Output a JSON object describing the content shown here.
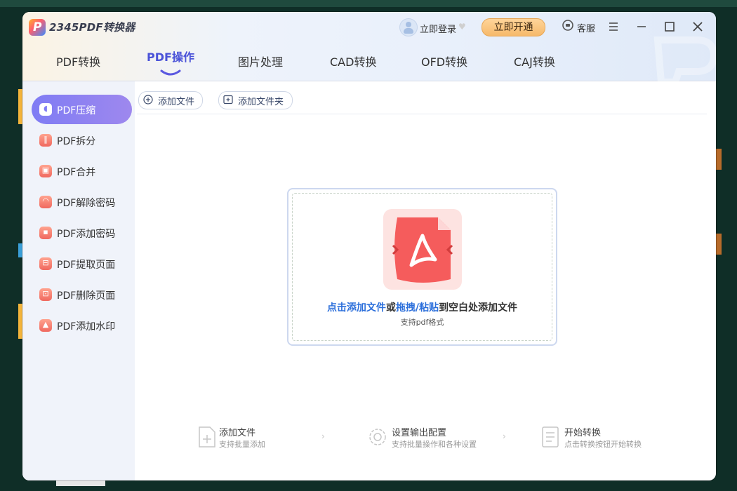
{
  "app": {
    "title": "2345PDF转换器",
    "logo_letter": "P"
  },
  "header": {
    "login_label": "立即登录",
    "vip_button": "立即开通",
    "service_label": "客服"
  },
  "tabs": [
    {
      "label": "PDF转换",
      "active": false
    },
    {
      "label": "PDF操作",
      "active": true
    },
    {
      "label": "图片处理",
      "active": false
    },
    {
      "label": "CAD转换",
      "active": false
    },
    {
      "label": "OFD转换",
      "active": false
    },
    {
      "label": "CAJ转换",
      "active": false
    }
  ],
  "sidebar": {
    "items": [
      {
        "label": "PDF压缩",
        "icon": "compress-icon",
        "active": true
      },
      {
        "label": "PDF拆分",
        "icon": "split-icon",
        "active": false
      },
      {
        "label": "PDF合并",
        "icon": "merge-icon",
        "active": false
      },
      {
        "label": "PDF解除密码",
        "icon": "unlock-icon",
        "active": false
      },
      {
        "label": "PDF添加密码",
        "icon": "lock-icon",
        "active": false
      },
      {
        "label": "PDF提取页面",
        "icon": "extract-icon",
        "active": false
      },
      {
        "label": "PDF删除页面",
        "icon": "delete-page-icon",
        "active": false
      },
      {
        "label": "PDF添加水印",
        "icon": "watermark-icon",
        "active": false
      }
    ]
  },
  "toolbar": {
    "add_file": "添加文件",
    "add_folder": "添加文件夹"
  },
  "dropzone": {
    "link_add": "点击添加文件",
    "or": "或",
    "link_drag": "拖拽/粘贴",
    "rest": "到空白处添加文件",
    "sub": "支持pdf格式"
  },
  "steps": [
    {
      "title": "添加文件",
      "sub": "支持批量添加",
      "icon": "add-file-icon"
    },
    {
      "title": "设置输出配置",
      "sub": "支持批量操作和各种设置",
      "icon": "settings-icon"
    },
    {
      "title": "开始转换",
      "sub": "点击转换按钮开始转换",
      "icon": "start-convert-icon"
    }
  ],
  "colors": {
    "accent": "#4a52d8",
    "link": "#2c6fdb",
    "vip": "#f6b96a",
    "sidebar_active": "#8c82f1"
  }
}
